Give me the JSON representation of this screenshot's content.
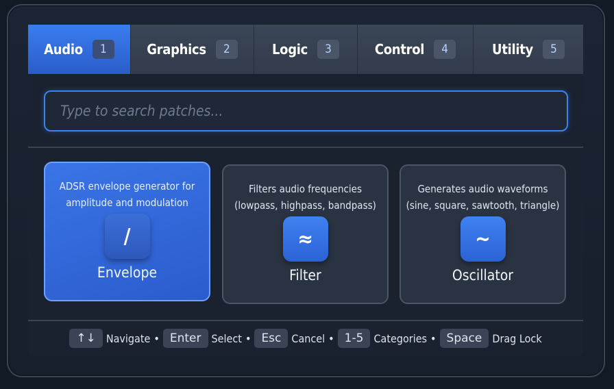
{
  "tabs": [
    {
      "label": "Audio",
      "num": "1",
      "active": true
    },
    {
      "label": "Graphics",
      "num": "2",
      "active": false
    },
    {
      "label": "Logic",
      "num": "3",
      "active": false
    },
    {
      "label": "Control",
      "num": "4",
      "active": false
    },
    {
      "label": "Utility",
      "num": "5",
      "active": false
    }
  ],
  "search": {
    "placeholder": "Type to search patches...",
    "value": ""
  },
  "cards": [
    {
      "title": "Envelope",
      "description": "ADSR envelope generator for amplitude and modulation",
      "icon": "slash-icon",
      "glyph": "/",
      "selected": true
    },
    {
      "title": "Filter",
      "description": "Filters audio frequencies (lowpass, highpass, bandpass)",
      "icon": "approx-wave-icon",
      "glyph": "≈",
      "selected": false
    },
    {
      "title": "Oscillator",
      "description": "Generates audio waveforms (sine, square, sawtooth, triangle)",
      "icon": "tilde-wave-icon",
      "glyph": "~",
      "selected": false
    }
  ],
  "footer": {
    "shortcuts": [
      {
        "key": "↑↓",
        "action": "Navigate"
      },
      {
        "key": "Enter",
        "action": "Select"
      },
      {
        "key": "Esc",
        "action": "Cancel"
      },
      {
        "key": "1-5",
        "action": "Categories"
      },
      {
        "key": "Space",
        "action": "Drag Lock"
      }
    ],
    "separator": "•"
  },
  "colors": {
    "accent": "#3a7df0",
    "background": "#121a26",
    "panel": "#1a2230"
  }
}
